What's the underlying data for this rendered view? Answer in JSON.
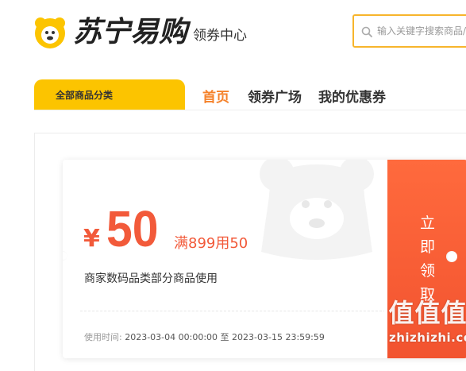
{
  "header": {
    "logo_text": "苏宁易购",
    "site_section": "领券中心",
    "search_placeholder": "输入关键字搜索商品/",
    "search_icon": "search-icon"
  },
  "nav": {
    "category_button": "全部商品分类",
    "links": [
      {
        "label": "首页",
        "active": true
      },
      {
        "label": "领券广场",
        "active": false
      },
      {
        "label": "我的优惠券",
        "active": false
      }
    ]
  },
  "coupon": {
    "currency": "¥",
    "value": "50",
    "condition": "满899用50",
    "scope": "商家数码品类部分商品使用",
    "time_label": "使用时间:",
    "time_start": "2023-03-04 00:00:00",
    "time_sep": "至",
    "time_end": "2023-03-15 23:59:59",
    "claim_chars": [
      "立",
      "即",
      "领",
      "取"
    ]
  },
  "watermark": {
    "mark": [
      "值",
      "值",
      "值"
    ],
    "url": "zhizhizhi.com"
  },
  "colors": {
    "brand_yellow": "#fcc400",
    "accent_orange": "#f5822b",
    "coupon_red": "#f25a3a",
    "search_border": "#f7b52c"
  }
}
